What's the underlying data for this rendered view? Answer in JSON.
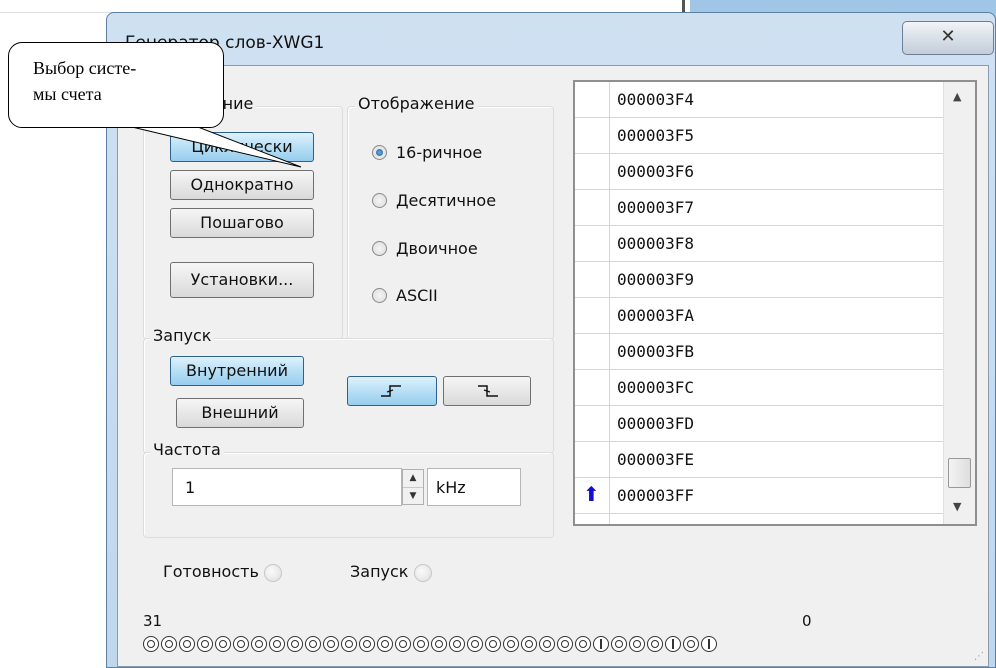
{
  "window": {
    "title": "Генератор слов-XWG1",
    "close_glyph": "✕"
  },
  "callout": {
    "line1": "Выбор систе-",
    "line2": "мы счета"
  },
  "controls": {
    "group_label": "Управление",
    "cyclic": "Циклически",
    "single": "Однократно",
    "step": "Пошагово",
    "settings": "Установки..."
  },
  "display": {
    "group_label": "Отображение",
    "options": [
      {
        "label": "16-ричное",
        "checked": true
      },
      {
        "label": "Десятичное",
        "checked": false
      },
      {
        "label": "Двоичное",
        "checked": false
      },
      {
        "label": "ASCII",
        "checked": false
      }
    ]
  },
  "trigger": {
    "group_label": "Запуск",
    "internal": "Внутренний",
    "external": "Внешний",
    "rising_glyph": "⎍",
    "falling_glyph": "⎍"
  },
  "frequency": {
    "group_label": "Частота",
    "value": "1",
    "unit": "kHz"
  },
  "memory": {
    "rows": [
      "000003F4",
      "000003F5",
      "000003F6",
      "000003F7",
      "000003F8",
      "000003F9",
      "000003FA",
      "000003FB",
      "000003FC",
      "000003FD",
      "000003FE",
      "000003FF"
    ],
    "marker_glyph": "⬆",
    "marked_row_index": 11,
    "scroll_up": "▲",
    "scroll_down": "▼"
  },
  "status": {
    "ready_label": "Готовность",
    "trigger_label": "Запуск"
  },
  "bits": {
    "msb_label": "31",
    "lsb_label": "0",
    "values": "00000000000000000000000001000101"
  },
  "colors": {
    "pressed_button": "#b7dff5",
    "marker": "#1010d0"
  }
}
